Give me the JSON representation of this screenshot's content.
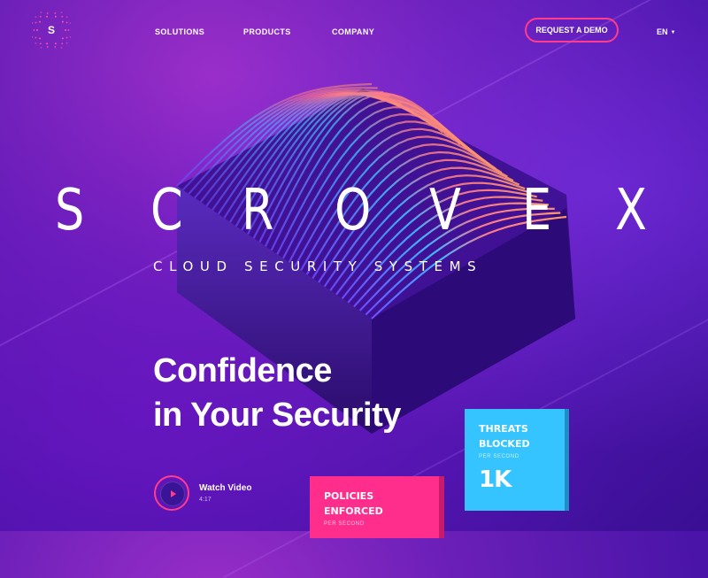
{
  "logo": {
    "letter": "S"
  },
  "nav": {
    "items": [
      {
        "label": "SOLUTIONS"
      },
      {
        "label": "PRODUCTS"
      },
      {
        "label": "COMPANY"
      }
    ],
    "cta_label": "REQUEST A DEMO",
    "language": "EN"
  },
  "hero": {
    "brand_letters": [
      "S",
      "C",
      "R",
      "O",
      "V",
      "E",
      "X"
    ],
    "tagline": "CLOUD SECURITY SYSTEMS",
    "headline_line1": "Confidence",
    "headline_line2": "in Your Security"
  },
  "video": {
    "title": "Watch Video",
    "duration": "4:17"
  },
  "cards": {
    "policies": {
      "title_line1": "POLICIES",
      "title_line2": "ENFORCED",
      "subtitle": "PER SECOND"
    },
    "threats": {
      "title_line1": "THREATS",
      "title_line2": "BLOCKED",
      "subtitle": "PER SECOND",
      "value": "1K"
    }
  },
  "colors": {
    "accent_pink": "#ff2d8c",
    "accent_blue": "#35c4ff",
    "background": "#5a19b0"
  }
}
